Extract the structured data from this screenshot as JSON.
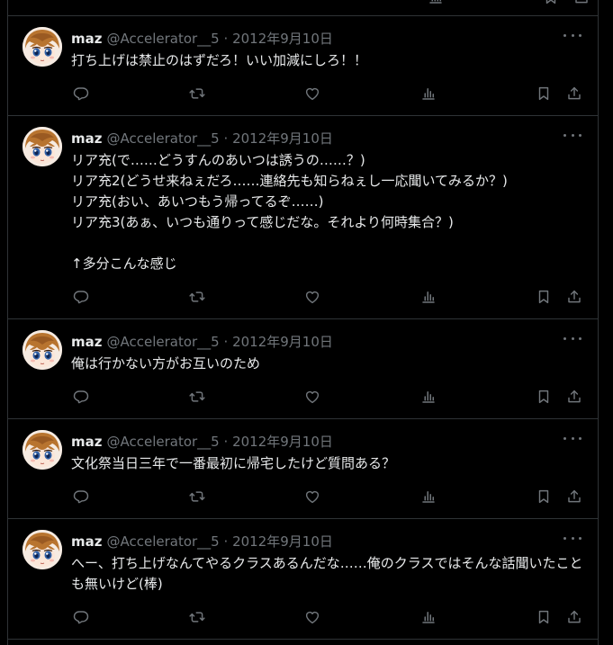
{
  "theme": {
    "background": "#000000",
    "text": "#e7e9ea",
    "muted": "#71767b",
    "border": "#2f3336"
  },
  "tweets": [
    {
      "name": "maz",
      "handle": "@Accelerator__5",
      "separator": "·",
      "date": "2012年9月10日",
      "lines": [
        "打ち上げは禁止のはずだろ！いい加減にしろ！！"
      ]
    },
    {
      "name": "maz",
      "handle": "@Accelerator__5",
      "separator": "·",
      "date": "2012年9月10日",
      "lines": [
        "リア充(で……どうすんのあいつは誘うの……？)",
        "リア充2(どうせ来ねぇだろ……連絡先も知らねぇし一応聞いてみるか？)",
        "リア充(おい、あいつもう帰ってるぞ……)",
        "リア充3(あぁ、いつも通りって感じだな。それより何時集合？)",
        "",
        "↑多分こんな感じ"
      ]
    },
    {
      "name": "maz",
      "handle": "@Accelerator__5",
      "separator": "·",
      "date": "2012年9月10日",
      "lines": [
        "俺は行かない方がお互いのため"
      ]
    },
    {
      "name": "maz",
      "handle": "@Accelerator__5",
      "separator": "·",
      "date": "2012年9月10日",
      "lines": [
        "文化祭当日三年で一番最初に帰宅したけど質問ある？"
      ]
    },
    {
      "name": "maz",
      "handle": "@Accelerator__5",
      "separator": "·",
      "date": "2012年9月10日",
      "text": "へー、打ち上げなんてやるクラスあるんだな……俺のクラスではそんな話聞いたことも無いけど(棒)"
    }
  ],
  "icons": {
    "more": "more-icon",
    "reply": "reply-icon",
    "retweet": "retweet-icon",
    "like": "like-icon",
    "views": "views-icon",
    "bookmark": "bookmark-icon",
    "share": "share-icon"
  }
}
